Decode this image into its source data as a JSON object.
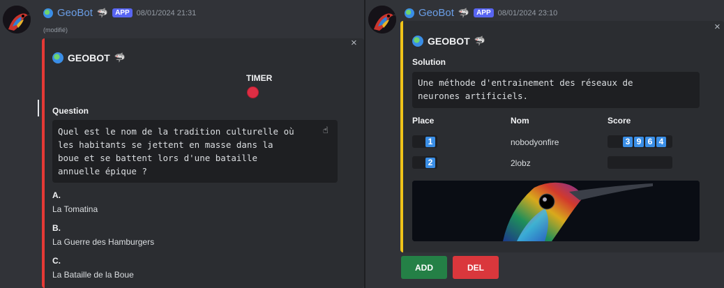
{
  "left": {
    "bot_name": "GeoBot",
    "app_badge": "APP",
    "timestamp": "08/01/2024 21:31",
    "edited": "(modifié)",
    "embed": {
      "title": "GEOBOT",
      "timer_label": "TIMER",
      "question_label": "Question",
      "question_lines": [
        "Quel est le nom de la tradition culturelle où",
        "les habitants se jettent en masse dans la",
        "boue et se battent lors d'une bataille",
        "annuelle épique ?"
      ],
      "answers": [
        {
          "letter": "A.",
          "text": "La Tomatina"
        },
        {
          "letter": "B.",
          "text": "La Guerre des Hamburgers"
        },
        {
          "letter": "C.",
          "text": "La Bataille de la Boue"
        }
      ],
      "close": "×"
    }
  },
  "right": {
    "bot_name": "GeoBot",
    "app_badge": "APP",
    "timestamp": "08/01/2024 23:10",
    "embed": {
      "title": "GEOBOT",
      "solution_label": "Solution",
      "solution_lines": [
        "Une méthode d'entrainement des réseaux de",
        "neurones artificiels."
      ],
      "col_place": "Place",
      "col_nom": "Nom",
      "col_score": "Score",
      "rows": [
        {
          "place": "1",
          "name": "nobodyonfire",
          "score_digits": [
            "3",
            "9",
            "6",
            "4"
          ]
        },
        {
          "place": "2",
          "name": "2lobz",
          "score_digits": []
        }
      ],
      "close": "×"
    },
    "buttons": {
      "add": "ADD",
      "del": "DEL"
    }
  },
  "colors": {
    "left_bar": "#e53935",
    "right_bar": "#f0c419",
    "add": "#248046",
    "del": "#da373c",
    "number_box": "#3a8ee6"
  },
  "icons": [
    "globe-icon",
    "shark-icon",
    "timer-dot-icon",
    "hand-cursor-icon",
    "close-icon"
  ]
}
